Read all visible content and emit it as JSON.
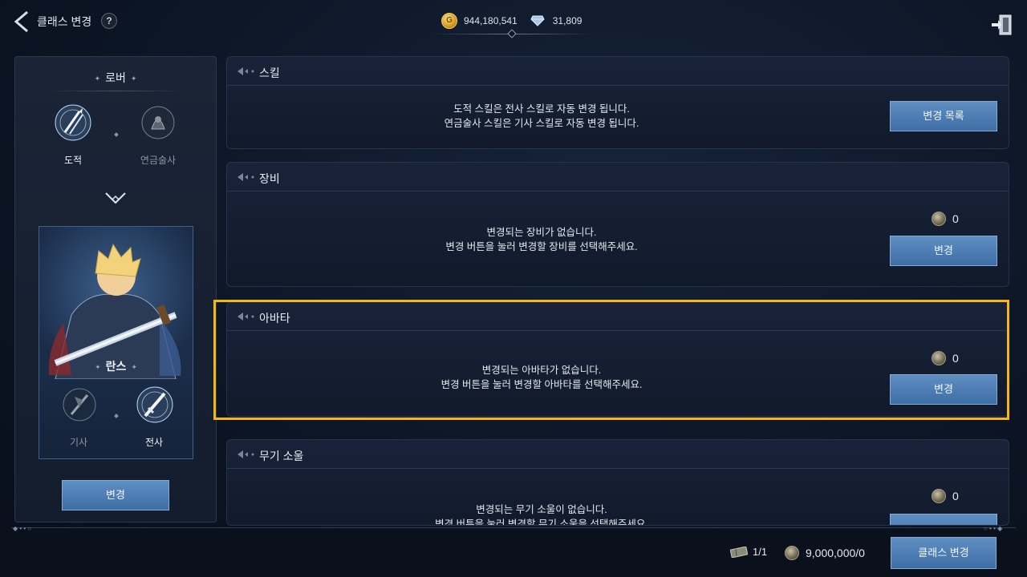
{
  "header": {
    "title": "클래스 변경",
    "help_label": "?",
    "gold_amount": "944,180,541",
    "diamond_amount": "31,809"
  },
  "left_panel": {
    "top_class": "로버",
    "top_options": [
      {
        "label": "도적",
        "selected": true
      },
      {
        "label": "연금술사",
        "selected": false
      }
    ],
    "character_name": "란스",
    "bottom_options": [
      {
        "label": "기사",
        "selected": false
      },
      {
        "label": "전사",
        "selected": true
      }
    ],
    "change_button": "변경"
  },
  "sections": {
    "skill": {
      "title": "스킬",
      "line1": "도적 스킬은 전사 스킬로 자동 변경 됩니다.",
      "line2": "연금술사 스킬은 기사 스킬로 자동 변경 됩니다.",
      "button": "변경 목록"
    },
    "equipment": {
      "title": "장비",
      "line1": "변경되는 장비가 없습니다.",
      "line2": "변경 버튼을 눌러 변경할 장비를 선택해주세요.",
      "cost": "0",
      "button": "변경"
    },
    "avatar": {
      "title": "아바타",
      "line1": "변경되는 아바타가 없습니다.",
      "line2": "변경 버튼을 눌러 변경할 아바타를 선택해주세요.",
      "cost": "0",
      "button": "변경"
    },
    "weapon_soul": {
      "title": "무기 소울",
      "line1": "변경되는 무기 소울이 없습니다.",
      "line2": "변경 버튼을 눌러 변경할 무기 소울을 선택해주세요.",
      "cost": "0"
    }
  },
  "footer": {
    "ticket_count": "1/1",
    "fee": "9,000,000/0",
    "class_change_button": "클래스 변경"
  },
  "colors": {
    "accent_button": "#4a7db3",
    "highlight": "#f8b80a",
    "background": "#0d1626"
  }
}
